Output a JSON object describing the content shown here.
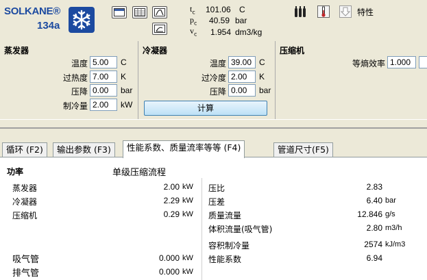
{
  "logo": {
    "brand": "SOLKANE®",
    "model": "134a"
  },
  "readout": {
    "tc_sym": "t",
    "tc_sub": "c",
    "tc_val": "101.06",
    "tc_unit": "C",
    "pc_sym": "p",
    "pc_sub": "c",
    "pc_val": "40.59",
    "pc_unit": "bar",
    "vc_sym": "v",
    "vc_sub": "c",
    "vc_val": "1.954",
    "vc_unit": "dm3/kg"
  },
  "toolbar": {
    "properties_label": "特性"
  },
  "evaporator": {
    "title": "蒸发器",
    "temp_label": "温度",
    "temp_value": "5.00",
    "temp_unit": "C",
    "superheat_label": "过热度",
    "superheat_value": "7.00",
    "superheat_unit": "K",
    "pdrop_label": "压降",
    "pdrop_value": "0.00",
    "pdrop_unit": "bar",
    "capacity_label": "制冷量",
    "capacity_value": "2.00",
    "capacity_unit": "kW"
  },
  "condenser": {
    "title": "冷凝器",
    "temp_label": "温度",
    "temp_value": "39.00",
    "temp_unit": "C",
    "subcool_label": "过冷度",
    "subcool_value": "2.00",
    "subcool_unit": "K",
    "pdrop_label": "压降",
    "pdrop_value": "0.00",
    "pdrop_unit": "bar",
    "calc_label": "计算"
  },
  "compressor": {
    "title": "压缩机",
    "eff_label": "等熵效率",
    "eff_value": "1.000"
  },
  "tabs": [
    {
      "label": "循环 (F2)"
    },
    {
      "label": "输出参数 (F3)"
    },
    {
      "label": "性能系数、质量流率等等 (F4)"
    },
    {
      "label": "管道尺寸(F5)"
    }
  ],
  "content": {
    "power_header": "功率",
    "process_title": "单级压缩流程",
    "left": [
      {
        "label": "蒸发器",
        "value": "2.00",
        "unit": "kW"
      },
      {
        "label": "冷凝器",
        "value": "2.29",
        "unit": "kW"
      },
      {
        "label": "压缩机",
        "value": "0.29",
        "unit": "kW"
      }
    ],
    "pipes": [
      {
        "label": "吸气管",
        "value": "0.000",
        "unit": "kW"
      },
      {
        "label": "排气管",
        "value": "0.000",
        "unit": "kW"
      }
    ],
    "right": [
      {
        "label": "压比",
        "value": "2.83",
        "unit": ""
      },
      {
        "label": "压差",
        "value": "6.40",
        "unit": "bar"
      },
      {
        "label": "质量流量",
        "value": "12.846",
        "unit": "g/s"
      },
      {
        "label": "体积流量(吸气管)",
        "value": "2.80",
        "unit": "m3/h"
      },
      {
        "label": "容积制冷量",
        "value": "2574",
        "unit": "kJ/m3"
      },
      {
        "label": "性能系数",
        "value": "6.94",
        "unit": ""
      }
    ]
  }
}
